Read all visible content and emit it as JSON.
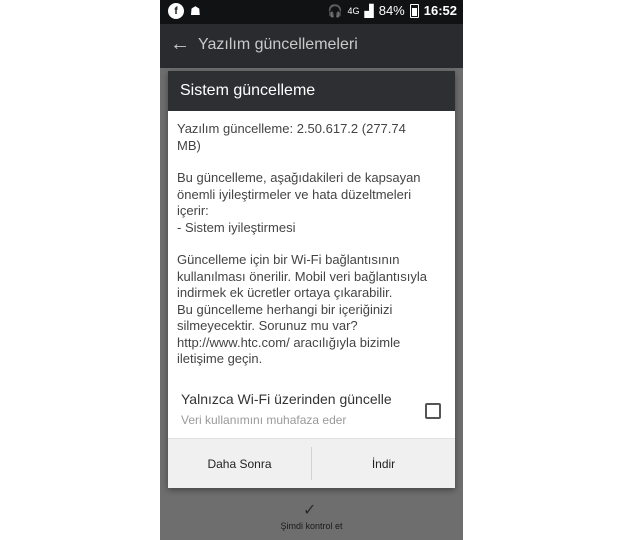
{
  "status_bar": {
    "left_icon_1": "f",
    "right_network": "4G",
    "battery_percent": "84%",
    "time": "16:52"
  },
  "app_bar": {
    "title": "Yazılım güncellemeleri"
  },
  "background": {
    "check_label": "Şimdi kontrol et"
  },
  "dialog": {
    "title": "Sistem güncelleme",
    "paragraphs": [
      "Yazılım güncelleme: 2.50.617.2 (277.74\nMB)",
      "Bu güncelleme, aşağıdakileri de kapsayan\nönemli iyileştirmeler ve hata düzeltmeleri\niçerir:\n- Sistem iyileştirmesi",
      "Güncelleme için bir Wi-Fi bağlantısının\nkullanılması önerilir. Mobil veri bağlantısıyla\nindirmek ek ücretler ortaya çıkarabilir.\nBu güncelleme herhangi bir içeriğinizi\nsilmeyecektir. Sorunuz mu var?\nhttp://www.htc.com/ aracılığıyla bizimle\niletişime geçin."
    ],
    "option": {
      "title": "Yalnızca Wi-Fi üzerinden güncelle",
      "subtitle": "Veri kullanımını muhafaza eder",
      "checked": false
    },
    "buttons": {
      "later": "Daha Sonra",
      "download": "İndir"
    }
  }
}
